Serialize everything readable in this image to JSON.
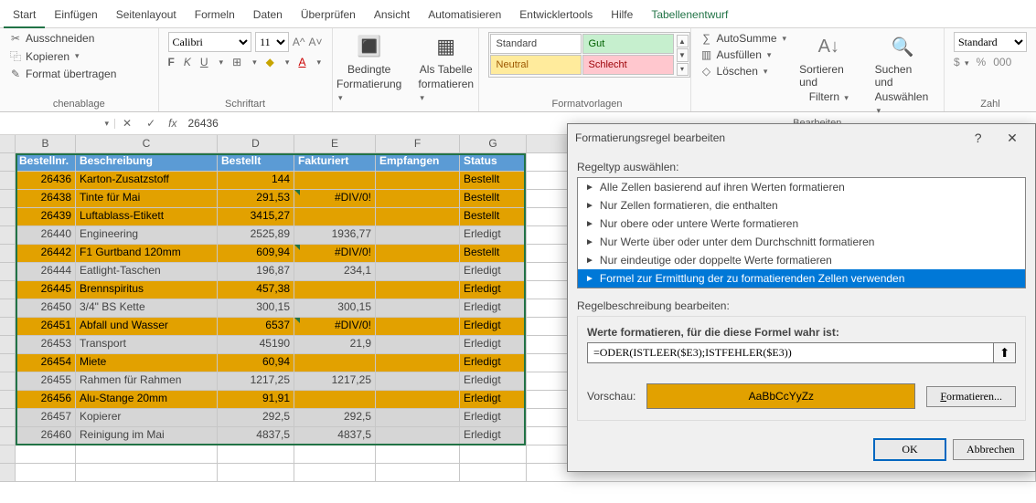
{
  "tabs": [
    "Start",
    "Einfügen",
    "Seitenlayout",
    "Formeln",
    "Daten",
    "Überprüfen",
    "Ansicht",
    "Automatisieren",
    "Entwicklertools",
    "Hilfe",
    "Tabellenentwurf"
  ],
  "ribbon": {
    "clipboard": {
      "cut": "Ausschneiden",
      "copy": "Kopieren",
      "fmt": "Format übertragen",
      "label": "chenablage"
    },
    "font": {
      "name": "Calibri",
      "size": "11",
      "label": "Schriftart",
      "bold": "F",
      "italic": "K",
      "ul": "U"
    },
    "cond": {
      "btn1": "Bedingte",
      "btn1b": "Formatierung",
      "btn2": "Als Tabelle",
      "btn2b": "formatieren"
    },
    "styles": {
      "standard": "Standard",
      "gut": "Gut",
      "neutral": "Neutral",
      "schlecht": "Schlecht",
      "label": "Formatvorlagen"
    },
    "editing": {
      "sum": "AutoSumme",
      "fill": "Ausfüllen",
      "clear": "Löschen",
      "sort": "Sortieren und",
      "sort2": "Filtern",
      "find": "Suchen und",
      "find2": "Auswählen",
      "label": "Bearbeiten"
    },
    "number": {
      "fmt": "Standard",
      "label": "Zahl",
      "pct": "%"
    }
  },
  "colheads": [
    "B",
    "C",
    "D",
    "E",
    "F",
    "G"
  ],
  "headers": {
    "a": "Bestellnr.",
    "b": "Beschreibung",
    "c": "Bestellt",
    "d": "Fakturiert",
    "e": "Empfangen",
    "f": "Status"
  },
  "rows": [
    {
      "cls": "gold",
      "n": "26436",
      "desc": "Karton-Zusatzstoff",
      "best": "144",
      "fakt": "",
      "emp": "",
      "st": "Bestellt"
    },
    {
      "cls": "gold",
      "n": "26438",
      "desc": "Tinte für Mai",
      "best": "291,53",
      "fakt": "#DIV/0!",
      "emp": "",
      "st": "Bestellt",
      "err": true
    },
    {
      "cls": "gold",
      "n": "26439",
      "desc": "Luftablass-Etikett",
      "best": "3415,27",
      "fakt": "",
      "emp": "",
      "st": "Bestellt"
    },
    {
      "cls": "grey",
      "n": "26440",
      "desc": "Engineering",
      "best": "2525,89",
      "fakt": "1936,77",
      "emp": "",
      "st": "Erledigt"
    },
    {
      "cls": "gold",
      "n": "26442",
      "desc": "F1 Gurtband 120mm",
      "best": "609,94",
      "fakt": "#DIV/0!",
      "emp": "",
      "st": "Bestellt",
      "err": true
    },
    {
      "cls": "grey",
      "n": "26444",
      "desc": "Eatlight-Taschen",
      "best": "196,87",
      "fakt": "234,1",
      "emp": "",
      "st": "Erledigt"
    },
    {
      "cls": "gold",
      "n": "26445",
      "desc": "Brennspiritus",
      "best": "457,38",
      "fakt": "",
      "emp": "",
      "st": "Erledigt"
    },
    {
      "cls": "grey",
      "n": "26450",
      "desc": "3/4\" BS Kette",
      "best": "300,15",
      "fakt": "300,15",
      "emp": "",
      "st": "Erledigt"
    },
    {
      "cls": "gold",
      "n": "26451",
      "desc": "Abfall und Wasser",
      "best": "6537",
      "fakt": "#DIV/0!",
      "emp": "",
      "st": "Erledigt",
      "err": true
    },
    {
      "cls": "grey",
      "n": "26453",
      "desc": "Transport",
      "best": "45190",
      "fakt": "21,9",
      "emp": "",
      "st": "Erledigt"
    },
    {
      "cls": "gold",
      "n": "26454",
      "desc": "Miete",
      "best": "60,94",
      "fakt": "",
      "emp": "",
      "st": "Erledigt"
    },
    {
      "cls": "grey",
      "n": "26455",
      "desc": "Rahmen für Rahmen",
      "best": "1217,25",
      "fakt": "1217,25",
      "emp": "",
      "st": "Erledigt"
    },
    {
      "cls": "gold",
      "n": "26456",
      "desc": "Alu-Stange 20mm",
      "best": "91,91",
      "fakt": "",
      "emp": "",
      "st": "Erledigt"
    },
    {
      "cls": "grey",
      "n": "26457",
      "desc": "Kopierer",
      "best": "292,5",
      "fakt": "292,5",
      "emp": "",
      "st": "Erledigt"
    },
    {
      "cls": "grey",
      "n": "26460",
      "desc": "Reinigung im Mai",
      "best": "4837,5",
      "fakt": "4837,5",
      "emp": "",
      "st": "Erledigt"
    }
  ],
  "fbar": {
    "fx": "fx",
    "value": "26436"
  },
  "dialog": {
    "title": "Formatierungsregel bearbeiten",
    "sec1": "Regeltyp auswählen:",
    "rules": [
      "Alle Zellen basierend auf ihren Werten formatieren",
      "Nur Zellen formatieren, die enthalten",
      "Nur obere oder untere Werte formatieren",
      "Nur Werte über oder unter dem Durchschnitt formatieren",
      "Nur eindeutige oder doppelte Werte formatieren",
      "Formel zur Ermittlung der zu formatierenden Zellen verwenden"
    ],
    "sec2": "Regelbeschreibung bearbeiten:",
    "sec3": "Werte formatieren, für die diese Formel wahr ist:",
    "formula": "=ODER(ISTLEER($E3);ISTFEHLER($E3))",
    "preview_lbl": "Vorschau:",
    "preview_text": "AaBbCcYyZz",
    "fmt_btn": "Formatieren...",
    "ok": "OK",
    "cancel": "Abbrechen",
    "help": "?",
    "close": "✕"
  }
}
